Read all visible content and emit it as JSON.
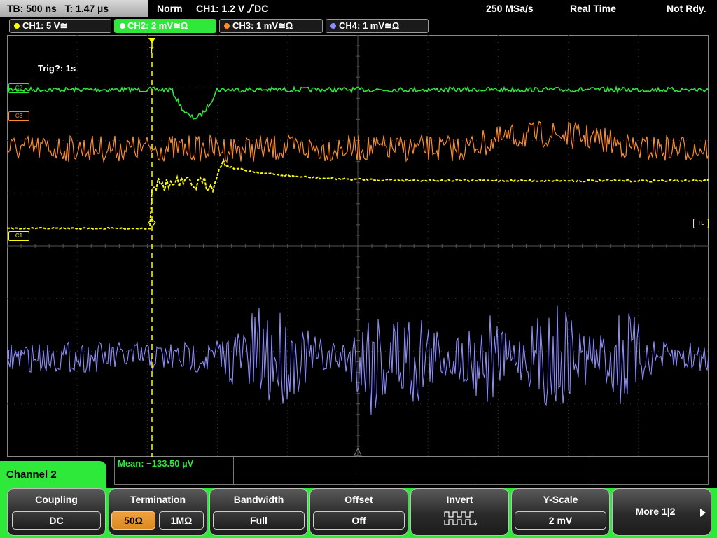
{
  "status": {
    "timebase": "TB: 500 ns",
    "time": "T: 1.47 µs",
    "mode": "Norm",
    "trigger": "CH1: 1.2 V",
    "trigger_edge": "⎍",
    "trigger_coupling": "DC",
    "sample_rate": "250 MSa/s",
    "acq_mode": "Real Time",
    "ready": "Not Rdy."
  },
  "channels": [
    {
      "label": "CH1: 5 V≅",
      "color": "#ffff00"
    },
    {
      "label": "CH2: 2 mV≅Ω",
      "color": "#2ee83a"
    },
    {
      "label": "CH3: 1 mV≅Ω",
      "color": "#ff8c28"
    },
    {
      "label": "CH4: 1 mV≅Ω",
      "color": "#8c8cff"
    }
  ],
  "screen": {
    "trig_info": "Trig?: 1s",
    "markers": {
      "c1": "C1",
      "c2": "C2",
      "c3": "C3",
      "c4": "C4",
      "tl": "TL",
      "trigger_pos": "T"
    }
  },
  "measurement": {
    "text": "Mean: −133.50 µV"
  },
  "menu": {
    "channel_tab": "Channel 2",
    "coupling": {
      "title": "Coupling",
      "value": "DC"
    },
    "termination": {
      "title": "Termination",
      "opt1": "50Ω",
      "opt2": "1MΩ"
    },
    "bandwidth": {
      "title": "Bandwidth",
      "value": "Full"
    },
    "offset": {
      "title": "Offset",
      "value": "Off"
    },
    "invert": {
      "title": "Invert"
    },
    "yscale": {
      "title": "Y-Scale",
      "value": "2 mV"
    },
    "more": {
      "label": "More 1|2"
    }
  }
}
